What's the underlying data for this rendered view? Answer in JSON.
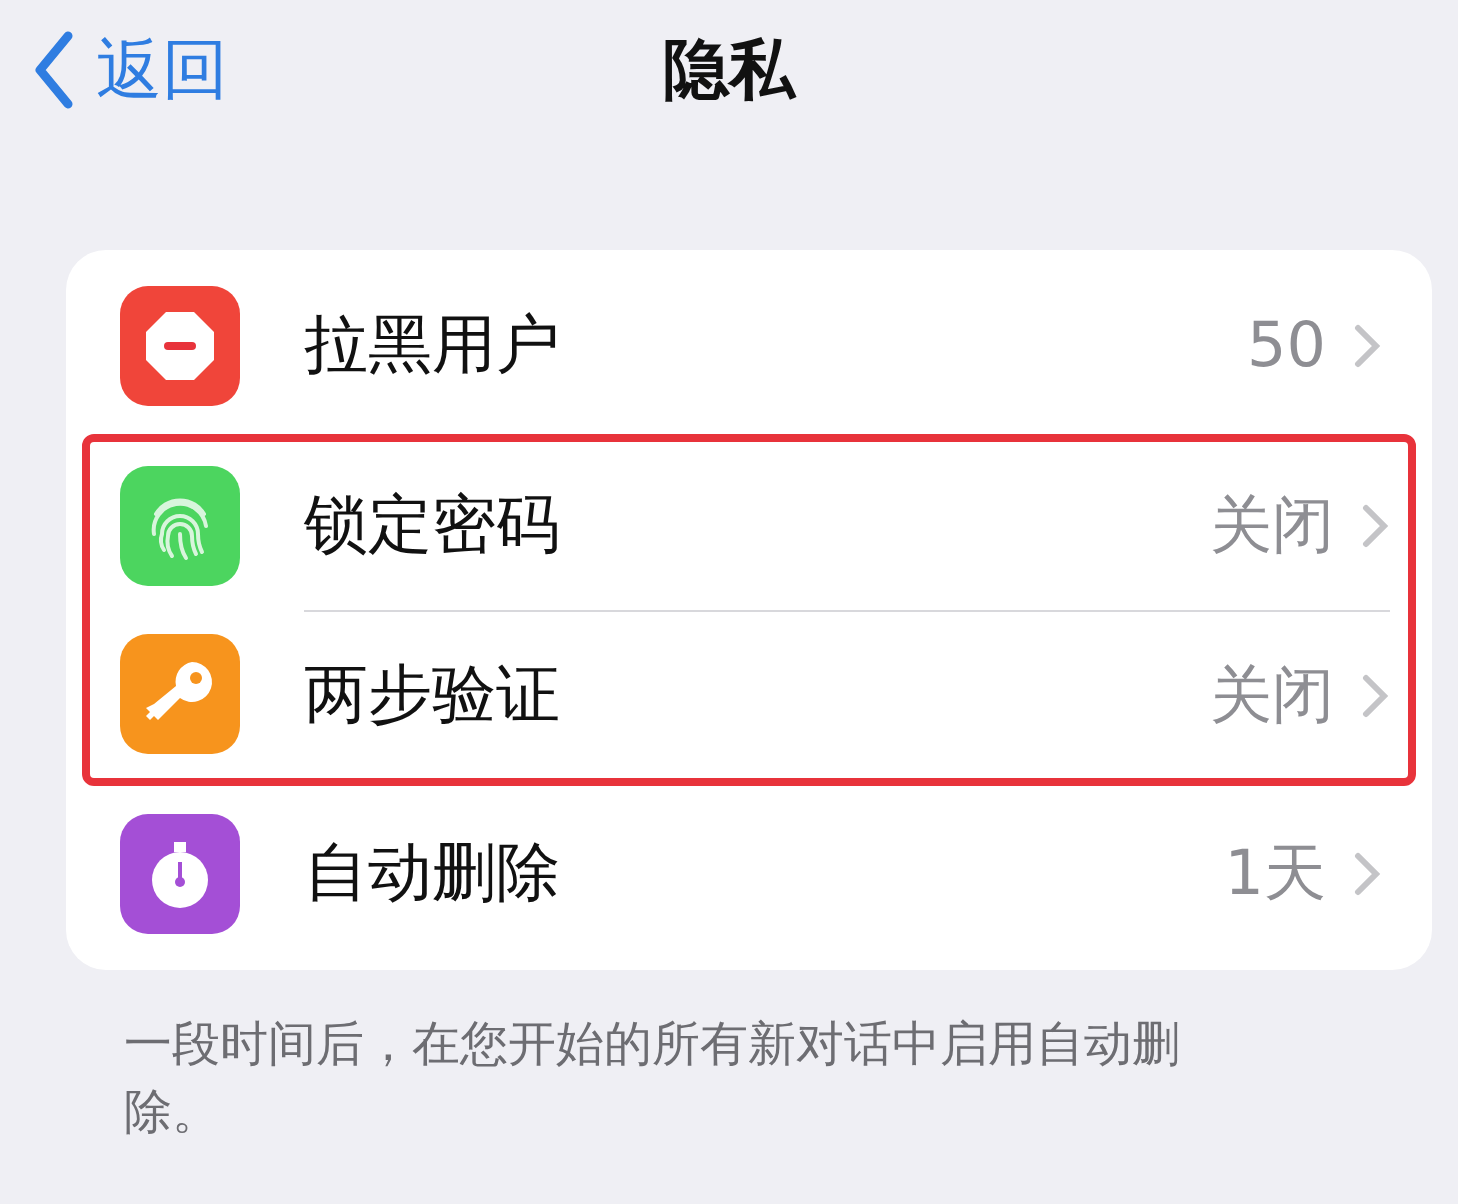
{
  "nav": {
    "back": "返回",
    "title": "隐私"
  },
  "rows": [
    {
      "kind": "blocked",
      "label": "拉黑用户",
      "value": "50",
      "highlighted": false
    },
    {
      "kind": "passcode",
      "label": "锁定密码",
      "value": "关闭",
      "highlighted": true
    },
    {
      "kind": "two-step",
      "label": "两步验证",
      "value": "关闭",
      "highlighted": true
    },
    {
      "kind": "auto-delete",
      "label": "自动删除",
      "value": "1天",
      "highlighted": false
    }
  ],
  "footer": "一段时间后，在您开始的所有新对话中启用自动删除。"
}
